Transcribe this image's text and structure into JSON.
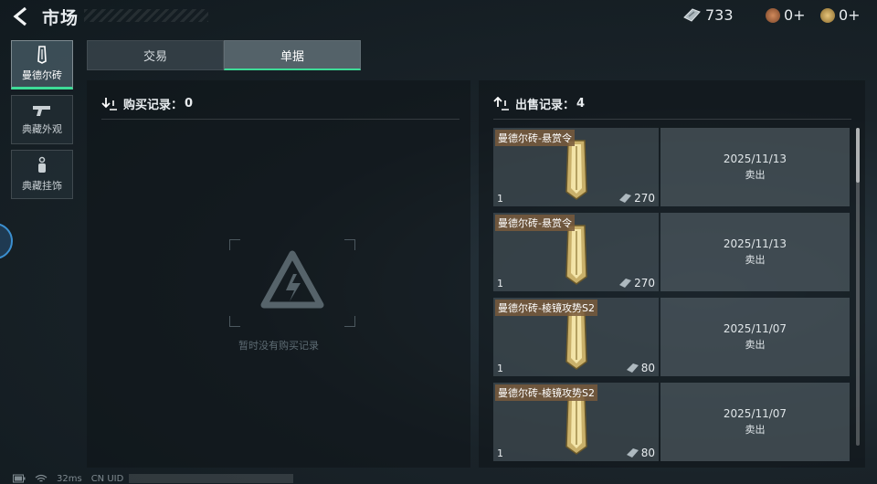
{
  "header": {
    "title": "市场",
    "currencies": [
      {
        "name": "ticket",
        "value": "733",
        "icon": "ticket-icon",
        "color": "#b7c2c8"
      },
      {
        "name": "bronze",
        "value": "0+",
        "icon": "bronze-coin-icon",
        "color": "#b8744a"
      },
      {
        "name": "gold",
        "value": "0+",
        "icon": "gold-coin-icon",
        "color": "#c9a255"
      }
    ]
  },
  "sidebar": {
    "items": [
      {
        "label": "曼德尔砖",
        "icon": "mandel-brick-icon",
        "active": true
      },
      {
        "label": "典藏外观",
        "icon": "gun-icon",
        "active": false
      },
      {
        "label": "典藏挂饰",
        "icon": "pendant-icon",
        "active": false
      }
    ]
  },
  "tabs": [
    {
      "label": "交易",
      "active": false
    },
    {
      "label": "单据",
      "active": true
    }
  ],
  "purchase": {
    "label": "购买记录：",
    "count": "0",
    "empty_text": "暂时没有购买记录"
  },
  "sale": {
    "label": "出售记录：",
    "count": "4",
    "records": [
      {
        "name": "曼德尔砖-悬赏令",
        "qty": "1",
        "price": "270",
        "date": "2025/11/13",
        "status": "卖出"
      },
      {
        "name": "曼德尔砖-悬赏令",
        "qty": "1",
        "price": "270",
        "date": "2025/11/13",
        "status": "卖出"
      },
      {
        "name": "曼德尔砖-棱镜攻势S2",
        "qty": "1",
        "price": "80",
        "date": "2025/11/07",
        "status": "卖出"
      },
      {
        "name": "曼德尔砖-棱镜攻势S2",
        "qty": "1",
        "price": "80",
        "date": "2025/11/07",
        "status": "卖出"
      }
    ]
  },
  "footer": {
    "ping": "32ms",
    "uid_label": "CN UID"
  },
  "colors": {
    "accent": "#3ddc97",
    "item_gold": "#d9c27a"
  }
}
